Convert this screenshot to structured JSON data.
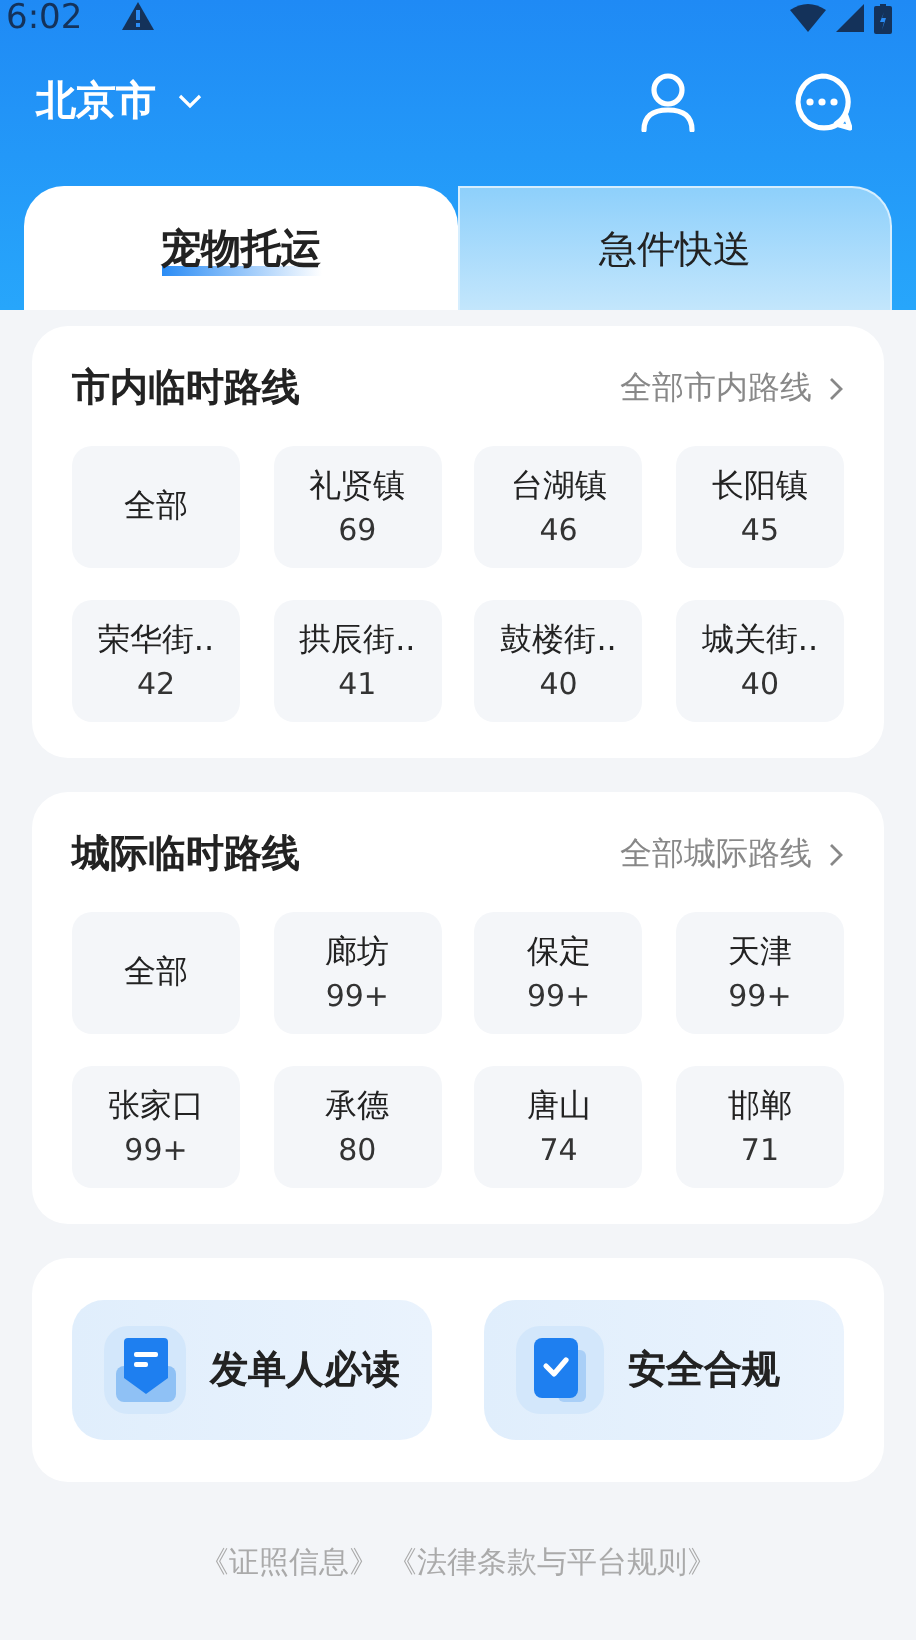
{
  "status_bar": {
    "time": "6:02"
  },
  "header": {
    "city": "北京市"
  },
  "tabs": [
    {
      "label": "宠物托运",
      "selected": true
    },
    {
      "label": "急件快送",
      "selected": false
    }
  ],
  "sections": [
    {
      "title": "市内临时路线",
      "more": "全部市内路线",
      "routes": [
        {
          "name": "全部"
        },
        {
          "name": "礼贤镇",
          "count": "69"
        },
        {
          "name": "台湖镇",
          "count": "46"
        },
        {
          "name": "长阳镇",
          "count": "45"
        },
        {
          "name": "荣华街..",
          "count": "42"
        },
        {
          "name": "拱辰街..",
          "count": "41"
        },
        {
          "name": "鼓楼街..",
          "count": "40"
        },
        {
          "name": "城关街..",
          "count": "40"
        }
      ]
    },
    {
      "title": "城际临时路线",
      "more": "全部城际路线",
      "routes": [
        {
          "name": "全部"
        },
        {
          "name": "廊坊",
          "count": "99+"
        },
        {
          "name": "保定",
          "count": "99+"
        },
        {
          "name": "天津",
          "count": "99+"
        },
        {
          "name": "张家口",
          "count": "99+"
        },
        {
          "name": "承德",
          "count": "80"
        },
        {
          "name": "唐山",
          "count": "74"
        },
        {
          "name": "邯郸",
          "count": "71"
        }
      ]
    }
  ],
  "guides": [
    {
      "label": "发单人必读",
      "kind": "doc"
    },
    {
      "label": "安全合规",
      "kind": "check"
    }
  ],
  "footer_links": [
    "《证照信息》",
    "《法律条款与平台规则》"
  ]
}
